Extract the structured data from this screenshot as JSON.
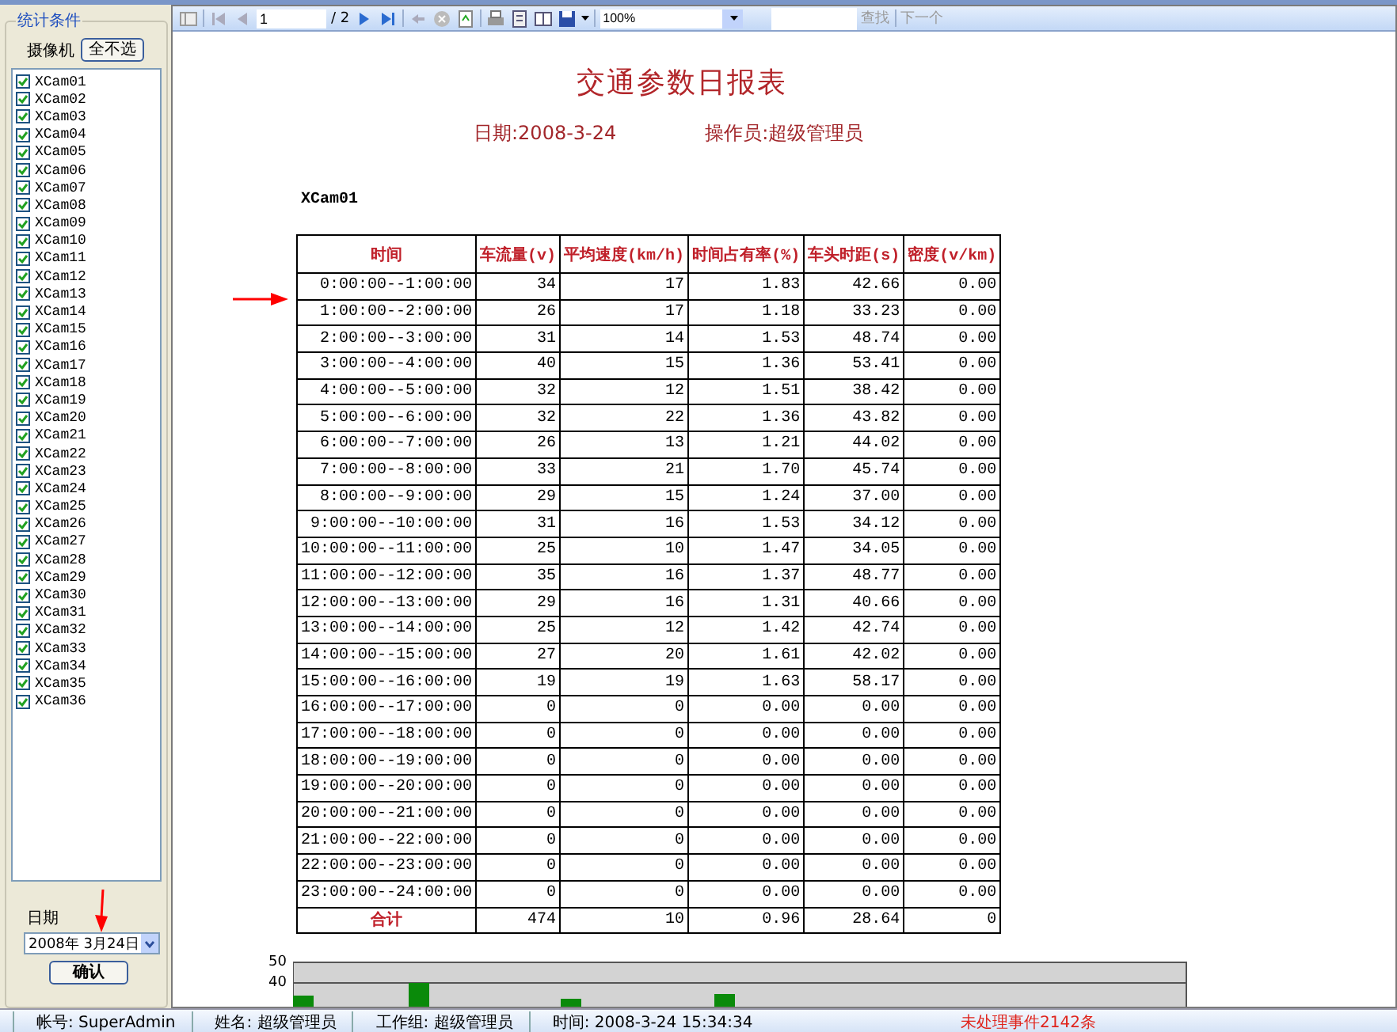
{
  "sidebar": {
    "group_title": "统计条件",
    "camera_label": "摄像机",
    "deselect_all_button": "全不选",
    "cameras": [
      {
        "label": "XCam01",
        "checked": true
      },
      {
        "label": "XCam02",
        "checked": true
      },
      {
        "label": "XCam03",
        "checked": true
      },
      {
        "label": "XCam04",
        "checked": true
      },
      {
        "label": "XCam05",
        "checked": true
      },
      {
        "label": "XCam06",
        "checked": true
      },
      {
        "label": "XCam07",
        "checked": true
      },
      {
        "label": "XCam08",
        "checked": true
      },
      {
        "label": "XCam09",
        "checked": true
      },
      {
        "label": "XCam10",
        "checked": true
      },
      {
        "label": "XCam11",
        "checked": true
      },
      {
        "label": "XCam12",
        "checked": true
      },
      {
        "label": "XCam13",
        "checked": true
      },
      {
        "label": "XCam14",
        "checked": true
      },
      {
        "label": "XCam15",
        "checked": true
      },
      {
        "label": "XCam16",
        "checked": true
      },
      {
        "label": "XCam17",
        "checked": true
      },
      {
        "label": "XCam18",
        "checked": true
      },
      {
        "label": "XCam19",
        "checked": true
      },
      {
        "label": "XCam20",
        "checked": true
      },
      {
        "label": "XCam21",
        "checked": true
      },
      {
        "label": "XCam22",
        "checked": true
      },
      {
        "label": "XCam23",
        "checked": true
      },
      {
        "label": "XCam24",
        "checked": true
      },
      {
        "label": "XCam25",
        "checked": true
      },
      {
        "label": "XCam26",
        "checked": true
      },
      {
        "label": "XCam27",
        "checked": true
      },
      {
        "label": "XCam28",
        "checked": true
      },
      {
        "label": "XCam29",
        "checked": true
      },
      {
        "label": "XCam30",
        "checked": true
      },
      {
        "label": "XCam31",
        "checked": true
      },
      {
        "label": "XCam32",
        "checked": true
      },
      {
        "label": "XCam33",
        "checked": true
      },
      {
        "label": "XCam34",
        "checked": true
      },
      {
        "label": "XCam35",
        "checked": true
      },
      {
        "label": "XCam36",
        "checked": true
      }
    ],
    "date_label": "日期",
    "date_value": "2008年 3月24日",
    "confirm_button": "确认"
  },
  "toolbar": {
    "page_input": "1",
    "page_total": "/ 2",
    "zoom": "100%",
    "find_button": "查找",
    "next_button": "下一个"
  },
  "report": {
    "title": "交通参数日报表",
    "date": "日期:2008-3-24",
    "operator": "操作员:超级管理员",
    "camera": "XCam01",
    "columns": [
      "时间",
      "车流量(v)",
      "平均速度(km/h)",
      "时间占有率(%)",
      "车头时距(s)",
      "密度(v/km)"
    ],
    "rows": [
      [
        "0:00:00--1:00:00",
        "34",
        "17",
        "1.83",
        "42.66",
        "0.00"
      ],
      [
        "1:00:00--2:00:00",
        "26",
        "17",
        "1.18",
        "33.23",
        "0.00"
      ],
      [
        "2:00:00--3:00:00",
        "31",
        "14",
        "1.53",
        "48.74",
        "0.00"
      ],
      [
        "3:00:00--4:00:00",
        "40",
        "15",
        "1.36",
        "53.41",
        "0.00"
      ],
      [
        "4:00:00--5:00:00",
        "32",
        "12",
        "1.51",
        "38.42",
        "0.00"
      ],
      [
        "5:00:00--6:00:00",
        "32",
        "22",
        "1.36",
        "43.82",
        "0.00"
      ],
      [
        "6:00:00--7:00:00",
        "26",
        "13",
        "1.21",
        "44.02",
        "0.00"
      ],
      [
        "7:00:00--8:00:00",
        "33",
        "21",
        "1.70",
        "45.74",
        "0.00"
      ],
      [
        "8:00:00--9:00:00",
        "29",
        "15",
        "1.24",
        "37.00",
        "0.00"
      ],
      [
        "9:00:00--10:00:00",
        "31",
        "16",
        "1.53",
        "34.12",
        "0.00"
      ],
      [
        "10:00:00--11:00:00",
        "25",
        "10",
        "1.47",
        "34.05",
        "0.00"
      ],
      [
        "11:00:00--12:00:00",
        "35",
        "16",
        "1.37",
        "48.77",
        "0.00"
      ],
      [
        "12:00:00--13:00:00",
        "29",
        "16",
        "1.31",
        "40.66",
        "0.00"
      ],
      [
        "13:00:00--14:00:00",
        "25",
        "12",
        "1.42",
        "42.74",
        "0.00"
      ],
      [
        "14:00:00--15:00:00",
        "27",
        "20",
        "1.61",
        "42.02",
        "0.00"
      ],
      [
        "15:00:00--16:00:00",
        "19",
        "19",
        "1.63",
        "58.17",
        "0.00"
      ],
      [
        "16:00:00--17:00:00",
        "0",
        "0",
        "0.00",
        "0.00",
        "0.00"
      ],
      [
        "17:00:00--18:00:00",
        "0",
        "0",
        "0.00",
        "0.00",
        "0.00"
      ],
      [
        "18:00:00--19:00:00",
        "0",
        "0",
        "0.00",
        "0.00",
        "0.00"
      ],
      [
        "19:00:00--20:00:00",
        "0",
        "0",
        "0.00",
        "0.00",
        "0.00"
      ],
      [
        "20:00:00--21:00:00",
        "0",
        "0",
        "0.00",
        "0.00",
        "0.00"
      ],
      [
        "21:00:00--22:00:00",
        "0",
        "0",
        "0.00",
        "0.00",
        "0.00"
      ],
      [
        "22:00:00--23:00:00",
        "0",
        "0",
        "0.00",
        "0.00",
        "0.00"
      ],
      [
        "23:00:00--24:00:00",
        "0",
        "0",
        "0.00",
        "0.00",
        "0.00"
      ]
    ],
    "total": [
      "合计",
      "474",
      "10",
      "0.96",
      "28.64",
      "0"
    ],
    "chart_ticks": [
      "50",
      "40"
    ]
  },
  "status_bar": [
    {
      "text": "帐号: SuperAdmin",
      "kind": "normal"
    },
    {
      "text": "姓名: 超级管理员",
      "kind": "normal"
    },
    {
      "text": "工作组: 超级管理员",
      "kind": "normal"
    },
    {
      "text": "时间: 2008-3-24 15:34:34",
      "kind": "normal"
    },
    {
      "text": "未处理事件2142条",
      "kind": "alert"
    }
  ]
}
